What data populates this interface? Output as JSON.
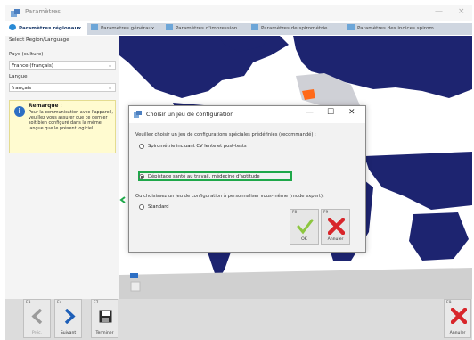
{
  "window": {
    "title": "Paramètres",
    "minimize": "—",
    "close": "×"
  },
  "tabs": [
    {
      "label": "Paramètres régionaux",
      "active": true
    },
    {
      "label": "Paramètres généraux",
      "active": false
    },
    {
      "label": "Paramètres d'impression",
      "active": false
    },
    {
      "label": "Paramètres de spirométrie",
      "active": false
    },
    {
      "label": "Paramètres des indices spirom...",
      "active": false
    }
  ],
  "left_panel": {
    "section_label": "Select Region/Language",
    "country_label": "Pays (culture)",
    "country_value": "France (français)",
    "language_label": "Langue",
    "language_value": "français",
    "note_title": "Remarque :",
    "note_body": "Pour la communication avec l'appareil, veuillez vous assurer que ce dernier soit bien configuré dans la même langue que le présent logiciel"
  },
  "dialog": {
    "title": "Choisir un jeu de configuration",
    "minimize": "—",
    "maximize": "☐",
    "close": "✕",
    "intro": "Veuillez choisir un jeu de configurations spéciales prédéfinies (recommandé) :",
    "option_1": "Spirométrie incluant CV lente et post-tests",
    "option_2": "Dépistage santé au travail, médecine d'aptitude",
    "selected_option": 2,
    "expert_prompt": "Ou choisissez un jeu de configuration à personnaliser vous-même (mode expert):",
    "option_3": "Standard",
    "ok_key": "F8",
    "ok_label": "OK",
    "cancel_key": "F9",
    "cancel_label": "Annuler"
  },
  "bottom_bar": {
    "prev_key": "F3",
    "prev_label": "Préc.",
    "next_key": "F4",
    "next_label": "Suivant",
    "finish_key": "F7",
    "finish_label": "Terminer",
    "cancel_key": "F9",
    "cancel_label": "Annuler"
  },
  "colors": {
    "map_land": "#1d2470",
    "map_land_grey": "#d0d0d0",
    "accent_green": "#1fa84a",
    "cancel_red": "#d8262b"
  }
}
